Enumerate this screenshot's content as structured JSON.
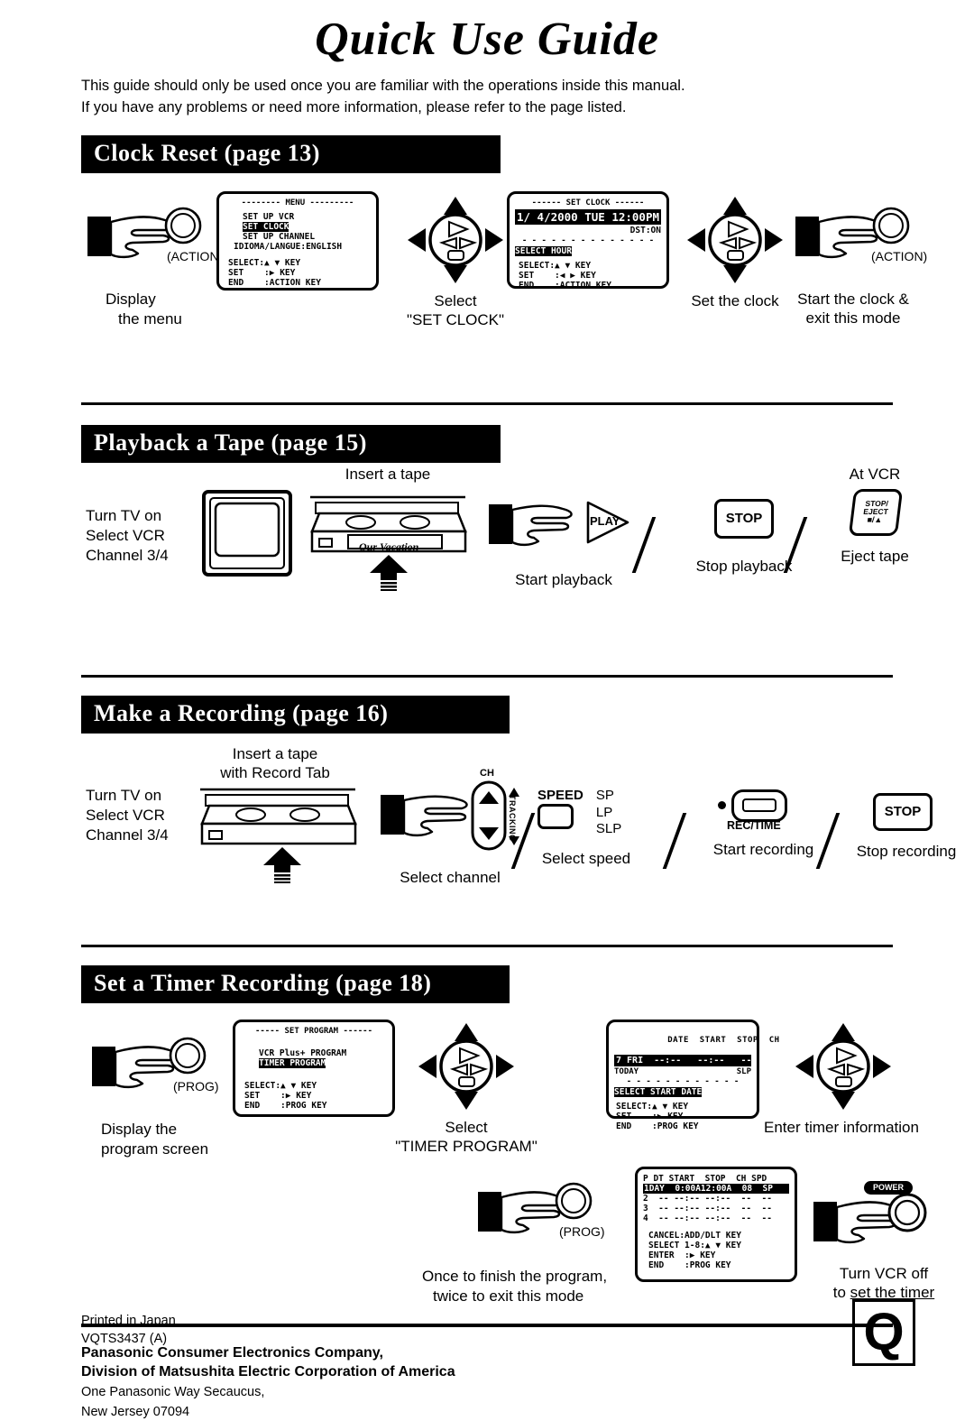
{
  "document": {
    "title": "Quick Use Guide",
    "intro_line1": "This guide should only be used once you are familiar with the operations inside this manual.",
    "intro_line2": "If you have any problems or need more information, please refer to the page listed."
  },
  "sections": [
    {
      "heading": "Clock Reset (page 13)",
      "steps": [
        {
          "caption_line1": "Display",
          "caption_line2": "the menu",
          "button_label": "(ACTION)"
        },
        {
          "screen": "menu"
        },
        {
          "caption_line1": "Select",
          "caption_line2": "\"SET CLOCK\""
        },
        {
          "screen": "set_clock"
        },
        {
          "caption_line1": "Set the clock"
        },
        {
          "caption_line1": "Start the clock &",
          "caption_line2": "exit this mode",
          "button_label": "(ACTION)"
        }
      ]
    },
    {
      "heading": "Playback a Tape (page 15)",
      "steps": [
        {
          "caption_line1": "Turn TV on",
          "caption_line2": "Select VCR",
          "caption_line3": "Channel 3/4"
        },
        {
          "caption_above": "Insert a tape",
          "tape_label": "Our Vacation"
        },
        {
          "caption_line1": "Start playback",
          "button_label": "PLAY"
        },
        {
          "caption_line1": "Stop playback",
          "button_label": "STOP"
        },
        {
          "caption_above": "At VCR",
          "caption_line1": "Eject tape",
          "button_label_1": "STOP/",
          "button_label_2": "EJECT",
          "button_label_3": "■/▲"
        }
      ]
    },
    {
      "heading": "Make a Recording (page 16)",
      "steps": [
        {
          "caption_line1": "Turn TV on",
          "caption_line2": "Select VCR",
          "caption_line3": "Channel 3/4"
        },
        {
          "caption_above_1": "Insert a tape",
          "caption_above_2": "with Record Tab"
        },
        {
          "caption_line1": "Select channel",
          "label_top": "CH",
          "label_side": "TRACKING"
        },
        {
          "caption_line1": "Select speed",
          "button_label": "SPEED",
          "options": [
            "SP",
            "LP",
            "SLP"
          ]
        },
        {
          "caption_line1": "Start recording",
          "button_label": "REC/TIME"
        },
        {
          "caption_line1": "Stop recording",
          "button_label": "STOP"
        }
      ]
    },
    {
      "heading": "Set a Timer Recording (page 18)",
      "steps": [
        {
          "caption_line1": "Display the",
          "caption_line2": "program screen",
          "button_label": "(PROG)"
        },
        {
          "screen": "set_program"
        },
        {
          "caption_line1": "Select",
          "caption_line2": "\"TIMER PROGRAM\""
        },
        {
          "screen": "timer_entry"
        },
        {
          "caption_line1": "Enter timer information"
        },
        {
          "caption_line1": "Once to finish the program,",
          "caption_line2": "twice to exit this mode",
          "button_label": "(PROG)"
        },
        {
          "screen": "program_list"
        },
        {
          "caption_line1": "Turn VCR off",
          "caption_line2_plain": "to ",
          "caption_line2_underline": "set the timer",
          "button_label": "POWER"
        }
      ]
    }
  ],
  "screens": {
    "menu": {
      "header": "MENU",
      "items": [
        "SET UP VCR",
        "SET CLOCK",
        "SET UP CHANNEL",
        "IDIOMA/LANGUE:ENGLISH"
      ],
      "highlighted": "SET CLOCK",
      "help": [
        "SELECT:▲ ▼ KEY",
        "SET    :▶ KEY",
        "END    :ACTION KEY"
      ]
    },
    "set_clock": {
      "header": "SET CLOCK",
      "datetime": "1/ 4/2000 TUE 12:00PM",
      "dst": "DST:ON",
      "prompt": "SELECT HOUR",
      "help": [
        "SELECT:▲ ▼ KEY",
        "SET    :◀ ▶ KEY",
        "END    :ACTION KEY"
      ]
    },
    "set_program": {
      "header": "SET PROGRAM",
      "items": [
        "VCR Plus+ PROGRAM",
        "TIMER PROGRAM"
      ],
      "highlighted": "TIMER PROGRAM",
      "help": [
        "SELECT:▲ ▼ KEY",
        "SET    :▶ KEY",
        "END    :PROG KEY"
      ]
    },
    "timer_entry": {
      "columns": [
        "DATE",
        "START",
        "STOP",
        "CH"
      ],
      "row": "7 FRI  --:--   --:--   --",
      "today": "TODAY",
      "speed": "SLP",
      "prompt": "SELECT START DATE",
      "help": [
        "SELECT:▲ ▼ KEY",
        "SET    :▶ KEY",
        "END    :PROG KEY"
      ]
    },
    "program_list": {
      "columns": "P DT START  STOP  CH SPD",
      "rows": [
        "1DAY  0:00A12:00A  08  SP",
        "2  -- --:-- --:--  --  --",
        "3  -- --:-- --:--  --  --",
        "4  -- --:-- --:--  --  --"
      ],
      "highlighted_row_index": 0,
      "help": [
        "CANCEL:ADD/DLT KEY",
        "SELECT 1-8:▲ ▼ KEY",
        "ENTER  :▶ KEY",
        "END    :PROG KEY"
      ]
    }
  },
  "footer": {
    "company_line1": "Panasonic Consumer Electronics Company,",
    "company_line2": "Division of Matsushita Electric Corporation of America",
    "address_line1": "One Panasonic Way Secaucus,",
    "address_line2": "New Jersey 07094",
    "printed_line1": "Printed in Japan",
    "printed_line2": "VQTS3437  (A)",
    "logo": "Q"
  }
}
